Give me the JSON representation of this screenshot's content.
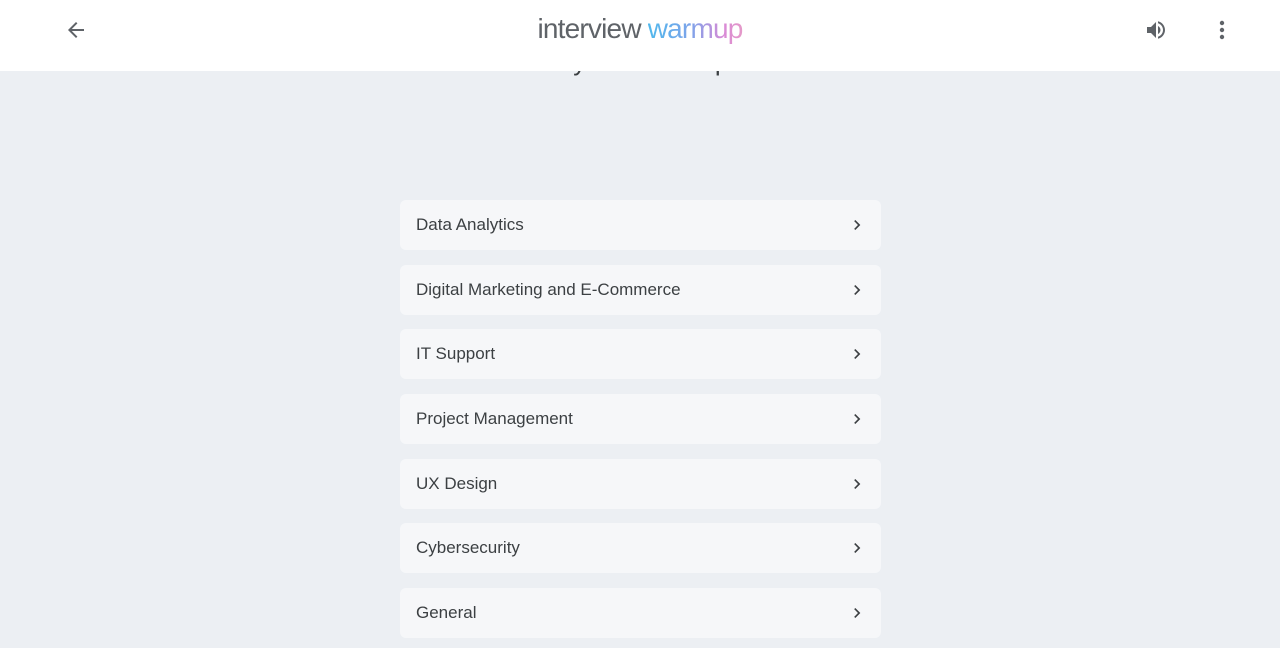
{
  "header": {
    "logo_part1": "interview",
    "logo_part2": "warmup",
    "back_icon": "arrow-left-icon",
    "volume_icon": "volume-up-icon",
    "more_icon": "more-vert-icon"
  },
  "scrolled_heading": "Let’s select your field to practice for",
  "fields": [
    {
      "label": "Data Analytics"
    },
    {
      "label": "Digital Marketing and E-Commerce"
    },
    {
      "label": "IT Support"
    },
    {
      "label": "Project Management"
    },
    {
      "label": "UX Design"
    },
    {
      "label": "Cybersecurity"
    },
    {
      "label": "General"
    }
  ],
  "colors": {
    "background": "#eceff3",
    "card": "#f6f7f9",
    "text": "#3c4043",
    "header": "#ffffff"
  }
}
